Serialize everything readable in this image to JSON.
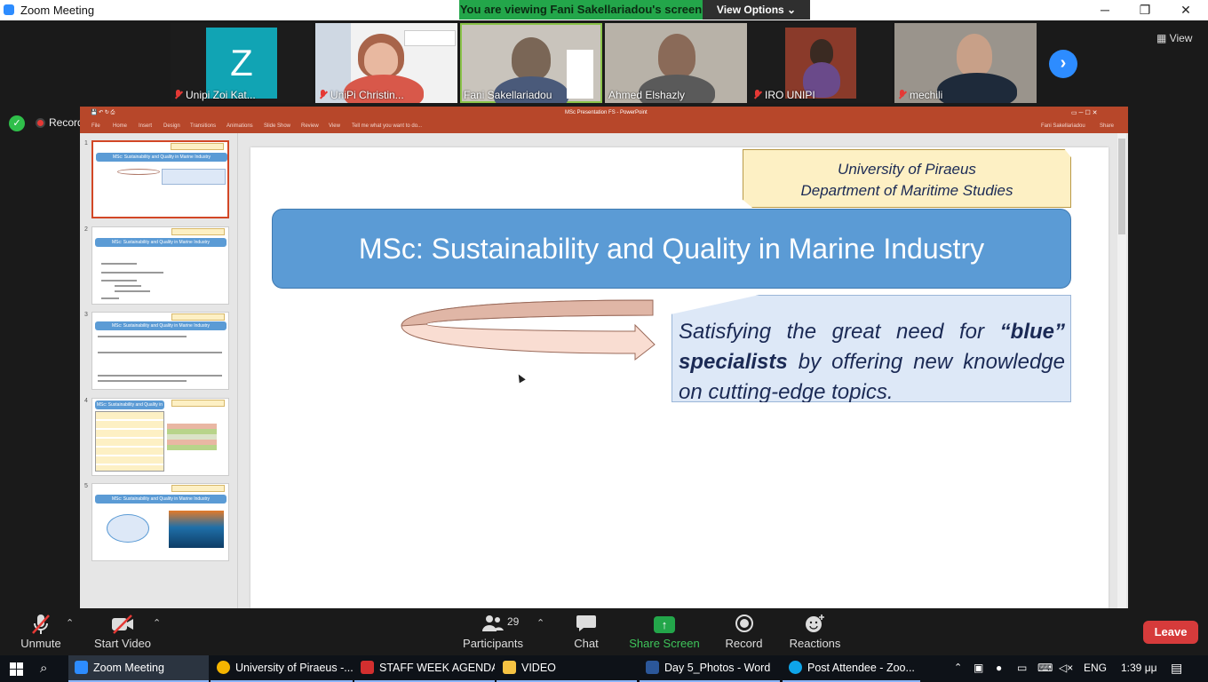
{
  "window": {
    "title": "Zoom Meeting",
    "minimize": "─",
    "maximize": "❐",
    "close": "✕"
  },
  "banner": {
    "viewing": "You are viewing Fani Sakellariadou's screen",
    "view_options": "View Options ⌄"
  },
  "gallery": {
    "view_label": "View",
    "participants": [
      {
        "name": "Unipi Zoi Kat...",
        "muted": true
      },
      {
        "name": "UniPi Christin...",
        "muted": true
      },
      {
        "name": "Fani Sakellariadou",
        "muted": false
      },
      {
        "name": "Ahmed Elshazly",
        "muted": false
      },
      {
        "name": "IRO UNIPI",
        "muted": true
      },
      {
        "name": "mechili",
        "muted": true
      }
    ],
    "avatar_letter": "Z",
    "next_icon": "›"
  },
  "recording": {
    "label": "Recording"
  },
  "powerpoint": {
    "window_title": "MSc Presentation FS - PowerPoint",
    "user": "Fani Sakellariadou",
    "share": "Share",
    "tabs": [
      "File",
      "Home",
      "Insert",
      "Design",
      "Transitions",
      "Animations",
      "Slide Show",
      "Review",
      "View"
    ],
    "tell_me": "Tell me what you want to do...",
    "thumbnails": [
      {
        "num": "1",
        "title": "MSc: Sustainability and Quality in Marine Industry"
      },
      {
        "num": "2",
        "title": "MSc: Sustainability and Quality in Marine Industry"
      },
      {
        "num": "3",
        "title": "MSc: Sustainability and Quality in Marine Industry"
      },
      {
        "num": "4",
        "title": "MSc: Sustainability and Quality in Marine Industry"
      },
      {
        "num": "5",
        "title": "MSc: Sustainability and Quality in Marine Industry"
      }
    ],
    "slide": {
      "uni_line1": "University of Piraeus",
      "uni_line2": "Department of Maritime Studies",
      "title": "MSc: Sustainability and Quality in Marine Industry",
      "quote_pre": "Satisfying the great need for ",
      "quote_blue": "“blue” specialists",
      "quote_post": " by offering new knowledge on cutting-edge topics."
    }
  },
  "toolbar": {
    "unmute": "Unmute",
    "start_video": "Start Video",
    "participants": "Participants",
    "participants_count": "29",
    "chat": "Chat",
    "share_screen": "Share Screen",
    "record": "Record",
    "reactions": "Reactions",
    "leave": "Leave"
  },
  "taskbar": {
    "items": [
      {
        "label": "Zoom Meeting",
        "color": "#2d8cff"
      },
      {
        "label": "University of Piraeus -...",
        "color": "#f4b400"
      },
      {
        "label": "STAFF WEEK AGENDA...",
        "color": "#d32f2f"
      },
      {
        "label": "VIDEO",
        "color": "#f6c343"
      },
      {
        "label": "Day 5_Photos - Word",
        "color": "#2b579a"
      },
      {
        "label": "Post Attendee - Zoo...",
        "color": "#0ea5e9"
      }
    ],
    "language": "ENG",
    "time": "1:39 μμ"
  }
}
